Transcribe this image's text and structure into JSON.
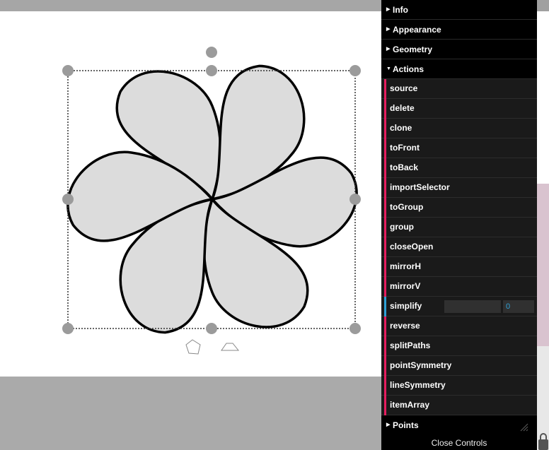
{
  "panel": {
    "folders": {
      "info": "Info",
      "appearance": "Appearance",
      "geometry": "Geometry",
      "actions": "Actions",
      "points": "Points"
    },
    "actions": [
      "source",
      "delete",
      "clone",
      "toFront",
      "toBack",
      "importSelector",
      "toGroup",
      "group",
      "closeOpen",
      "mirrorH",
      "mirrorV",
      "simplify",
      "reverse",
      "splitPaths",
      "pointSymmetry",
      "lineSymmetry",
      "itemArray"
    ],
    "simplify_value": "0",
    "close_label": "Close Controls"
  },
  "colors": {
    "accent_function": "#e61d5f",
    "accent_number": "#2fa1d6",
    "petal_fill": "#dcdcdc",
    "handle": "#9b9b9b"
  },
  "icons": [
    "handle-rotate-icon",
    "pentagon-tool-icon",
    "trapezoid-tool-icon",
    "resize-grip-icon",
    "lock-icon"
  ]
}
